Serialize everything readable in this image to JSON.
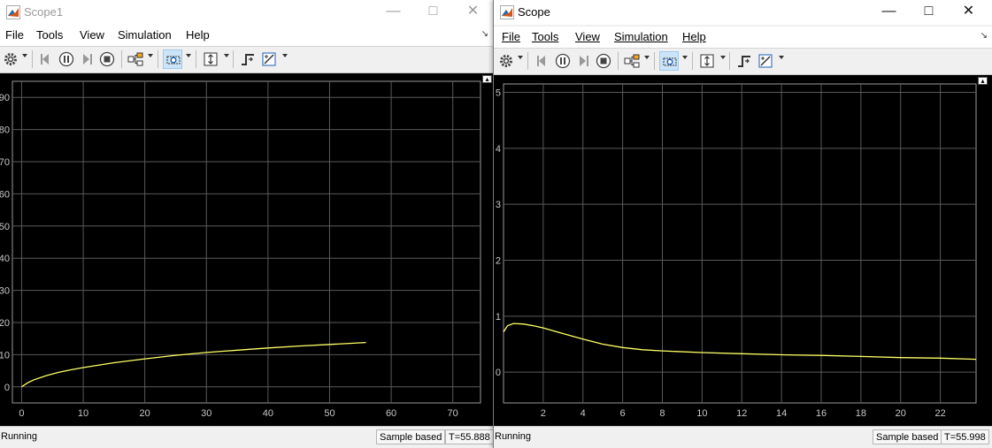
{
  "windows": [
    {
      "title": "Scope1",
      "menu": [
        "File",
        "Tools",
        "View",
        "Simulation",
        "Help"
      ],
      "toolbar_icons": [
        "settings-icon",
        "step-back-icon",
        "pause-icon",
        "step-forward-icon",
        "stop-icon",
        "highlight-simulink-block-icon",
        "zoom-icon",
        "scale-axes-icon",
        "triggers-icon",
        "cursor-measurements-icon"
      ],
      "status": {
        "state": "Running",
        "mode": "Sample based",
        "time": "T=55.888"
      }
    },
    {
      "title": "Scope",
      "menu": [
        "File",
        "Tools",
        "View",
        "Simulation",
        "Help"
      ],
      "toolbar_icons": [
        "settings-icon",
        "step-back-icon",
        "pause-icon",
        "step-forward-icon",
        "stop-icon",
        "highlight-simulink-block-icon",
        "zoom-icon",
        "scale-axes-icon",
        "triggers-icon",
        "cursor-measurements-icon"
      ],
      "status": {
        "state": "Running",
        "mode": "Sample based",
        "time": "T=55.998"
      }
    }
  ],
  "chart_data": [
    {
      "type": "line",
      "background": "#000000",
      "grid": true,
      "line_color": "#ffff66",
      "xlim": [
        -1.5,
        74.5
      ],
      "ylim": [
        -5,
        95
      ],
      "xticks": [
        0,
        10,
        20,
        30,
        40,
        50,
        60,
        70
      ],
      "yticks": [
        0,
        10,
        20,
        30,
        40,
        50,
        60,
        70,
        80,
        90
      ],
      "ytick_labels": [
        "0",
        "10",
        "20",
        "30",
        "40",
        "50",
        "60",
        "70",
        "80",
        "90"
      ],
      "x": [
        0,
        1,
        2,
        4,
        6,
        8,
        10,
        15,
        20,
        25,
        30,
        35,
        40,
        45,
        50,
        55.888
      ],
      "y": [
        0,
        1.3,
        2.2,
        3.5,
        4.5,
        5.3,
        6.0,
        7.5,
        8.7,
        9.8,
        10.7,
        11.4,
        12.1,
        12.7,
        13.2,
        13.8
      ]
    },
    {
      "type": "line",
      "background": "#000000",
      "grid": true,
      "line_color": "#ffff66",
      "xlim": [
        0,
        23.8
      ],
      "ylim": [
        -0.55,
        5.15
      ],
      "xticks": [
        2,
        4,
        6,
        8,
        10,
        12,
        14,
        16,
        18,
        20,
        22
      ],
      "yticks": [
        0,
        1,
        2,
        3,
        4,
        5
      ],
      "ytick_labels": [
        "0",
        "1",
        "2",
        "3",
        "4",
        "5"
      ],
      "x": [
        0,
        0.2,
        0.5,
        1,
        1.5,
        2,
        3,
        4,
        5,
        6,
        7,
        8,
        10,
        12,
        14,
        16,
        18,
        20,
        22,
        23.8
      ],
      "y": [
        0.72,
        0.83,
        0.87,
        0.86,
        0.83,
        0.79,
        0.69,
        0.59,
        0.5,
        0.44,
        0.4,
        0.38,
        0.35,
        0.33,
        0.31,
        0.3,
        0.28,
        0.26,
        0.25,
        0.23
      ]
    }
  ]
}
